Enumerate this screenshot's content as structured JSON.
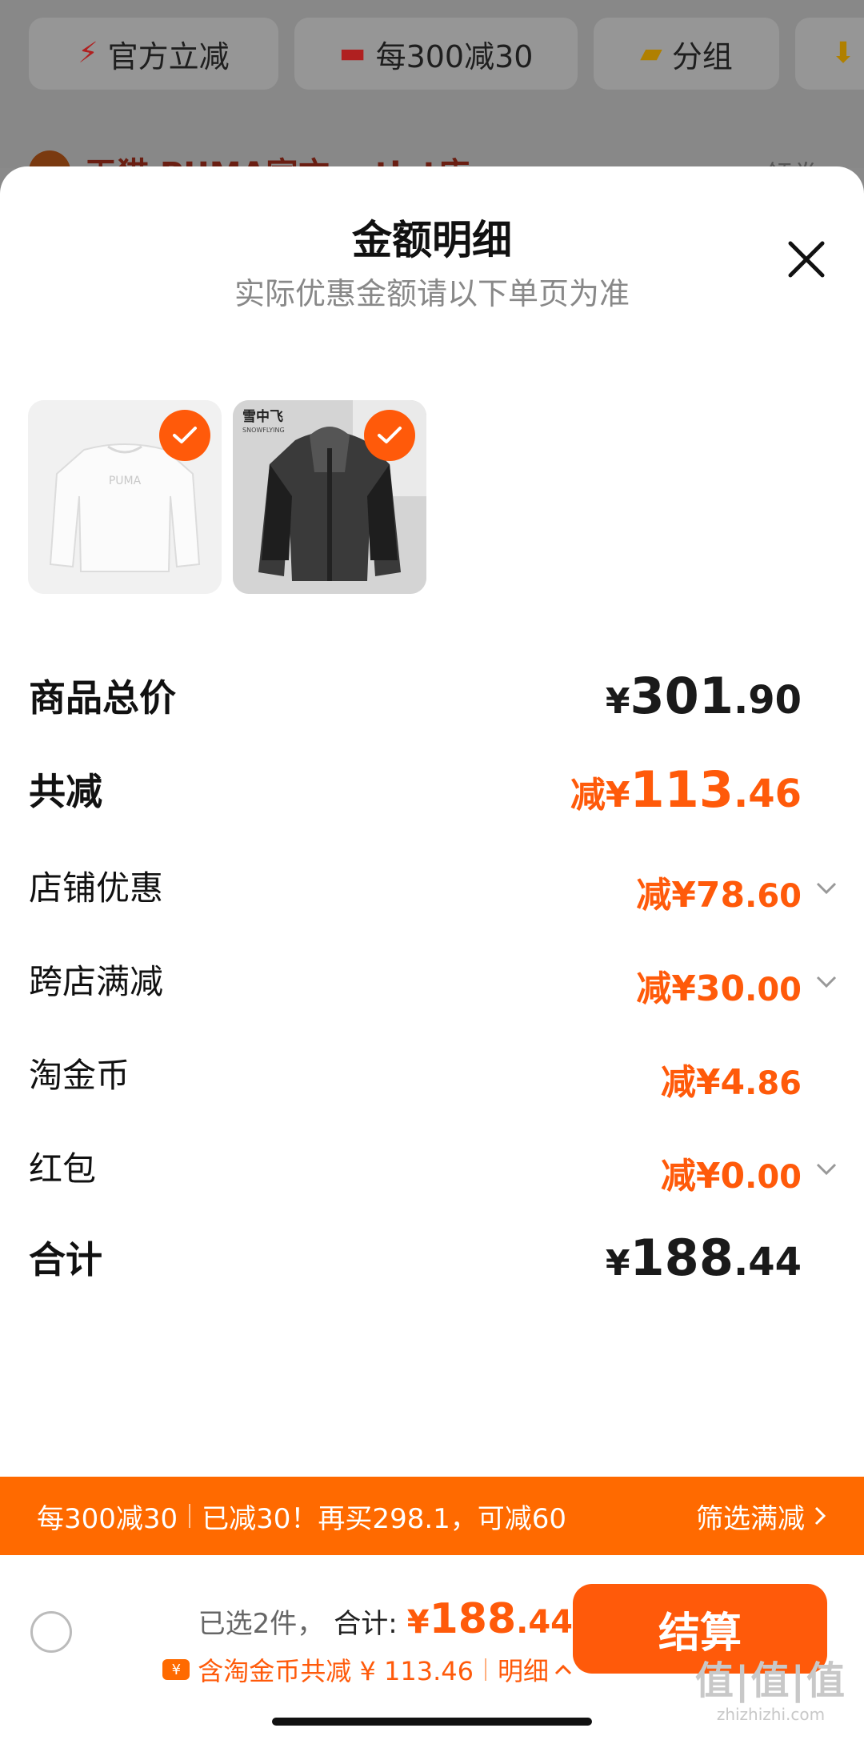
{
  "background": {
    "chips": [
      {
        "label": "官方立减",
        "icon": "lightning-icon"
      },
      {
        "label": "每300减30",
        "icon": "coupon-icon"
      },
      {
        "label": "分组",
        "icon": "folder-icon"
      }
    ],
    "shop": {
      "name": "天猫 PUMA官方outlet店",
      "right": "领券"
    }
  },
  "sheet": {
    "title": "金额明细",
    "subtitle": "实际优惠金额请以下单页为准",
    "products": [
      {
        "name": "white-sweatshirt",
        "brand_mark": "PUMA"
      },
      {
        "name": "dark-jacket",
        "brand_mark": "雪中飞",
        "brand_sub": "SNOWFLYING"
      }
    ],
    "rows": {
      "total": {
        "label": "商品总价",
        "prefix": "¥",
        "int": "301",
        "dec": ".90"
      },
      "discount": {
        "label": "共减",
        "prefix": "减¥",
        "int": "113",
        "dec": ".46"
      },
      "shop_coupon": {
        "label": "店铺优惠",
        "prefix": "减¥",
        "int": "78",
        "dec": ".60"
      },
      "cross_store": {
        "label": "跨店满减",
        "prefix": "减¥",
        "int": "30",
        "dec": ".00"
      },
      "tao_coin": {
        "label": "淘金币",
        "prefix": "减¥",
        "int": "4",
        "dec": ".86"
      },
      "red_packet": {
        "label": "红包",
        "prefix": "减¥",
        "int": "0",
        "dec": ".00"
      },
      "grand_total": {
        "label": "合计",
        "prefix": "¥",
        "int": "188",
        "dec": ".44"
      }
    }
  },
  "promo_bar": {
    "left_a": "每300减30",
    "left_b": "已减30！再买298.1，可减60",
    "right": "筛选满减"
  },
  "footer": {
    "selected": "已选2件，",
    "total_label": "合计:",
    "price_prefix": "¥",
    "price_int": "188",
    "price_dec": ".44",
    "coin_icon_text": "¥",
    "savings": "含淘金币共减 ¥ 113.46",
    "detail": "明细",
    "checkout": "结算"
  },
  "watermark": {
    "main": "值|值|值",
    "sub": "zhizhizhi.com"
  },
  "colors": {
    "accent": "#ff5a0a",
    "promo_bar": "#ff6a00"
  }
}
